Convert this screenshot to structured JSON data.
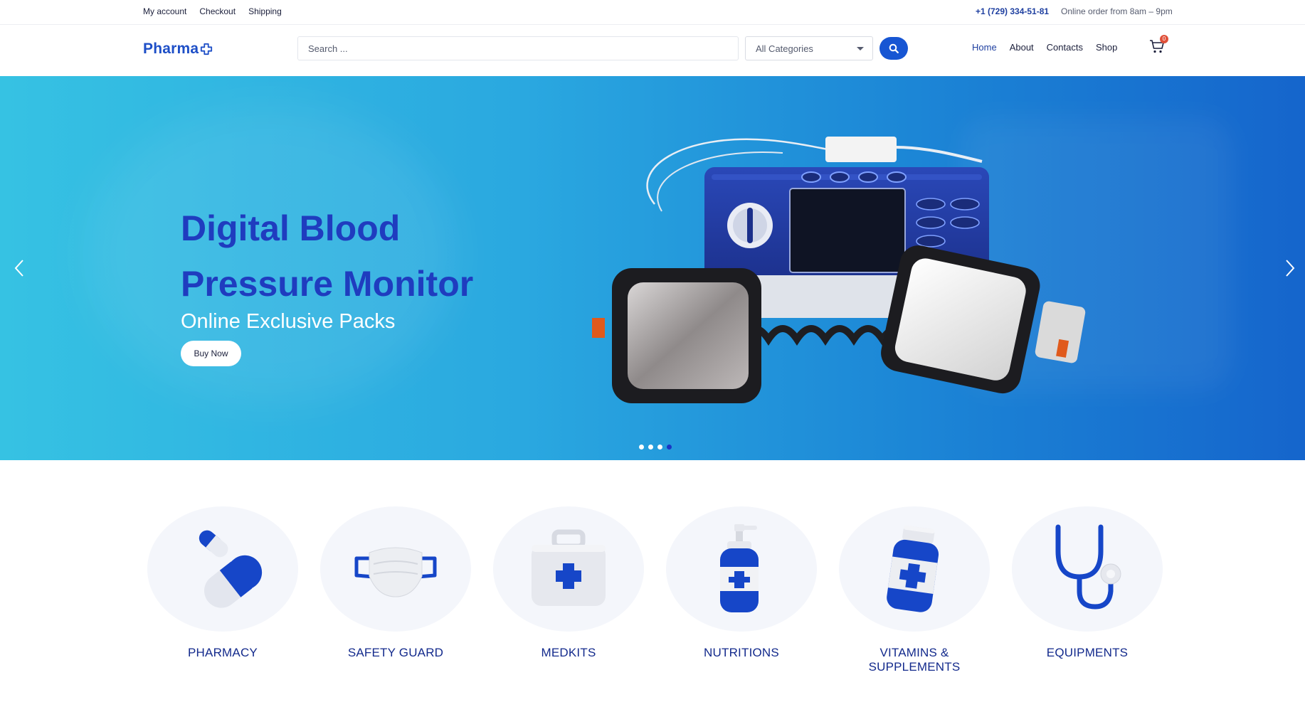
{
  "topbar": {
    "links": [
      "My account",
      "Checkout",
      "Shipping"
    ],
    "phone": "+1 (729) 334-51-81",
    "hours": "Online order from 8am – 9pm"
  },
  "header": {
    "logo_text": "Pharma",
    "search_placeholder": "Search ...",
    "category_select": "All Categories",
    "nav": [
      "Home",
      "About",
      "Contacts",
      "Shop"
    ],
    "active_nav": "Home",
    "cart_count": "0"
  },
  "hero": {
    "title_line1": "Digital Blood",
    "title_line2": "Pressure Monitor",
    "subtitle": "Online Exclusive Packs",
    "button": "Buy Now",
    "slide_count": 4,
    "active_slide": 4
  },
  "categories": [
    {
      "label": "PHARMACY",
      "icon": "pills-icon"
    },
    {
      "label": "SAFETY GUARD",
      "icon": "face-mask-icon"
    },
    {
      "label": "MEDKITS",
      "icon": "first-aid-kit-icon"
    },
    {
      "label": "NUTRITIONS",
      "icon": "pump-bottle-icon"
    },
    {
      "label": "VITAMINS & SUPPLEMENTS",
      "icon": "vitamin-bottle-icon"
    },
    {
      "label": "EQUIPMENTS",
      "icon": "stethoscope-icon"
    }
  ],
  "colors": {
    "brand": "#1756d3",
    "heading": "#1f3cbf",
    "category_label": "#132a8c",
    "badge": "#e0513a"
  }
}
